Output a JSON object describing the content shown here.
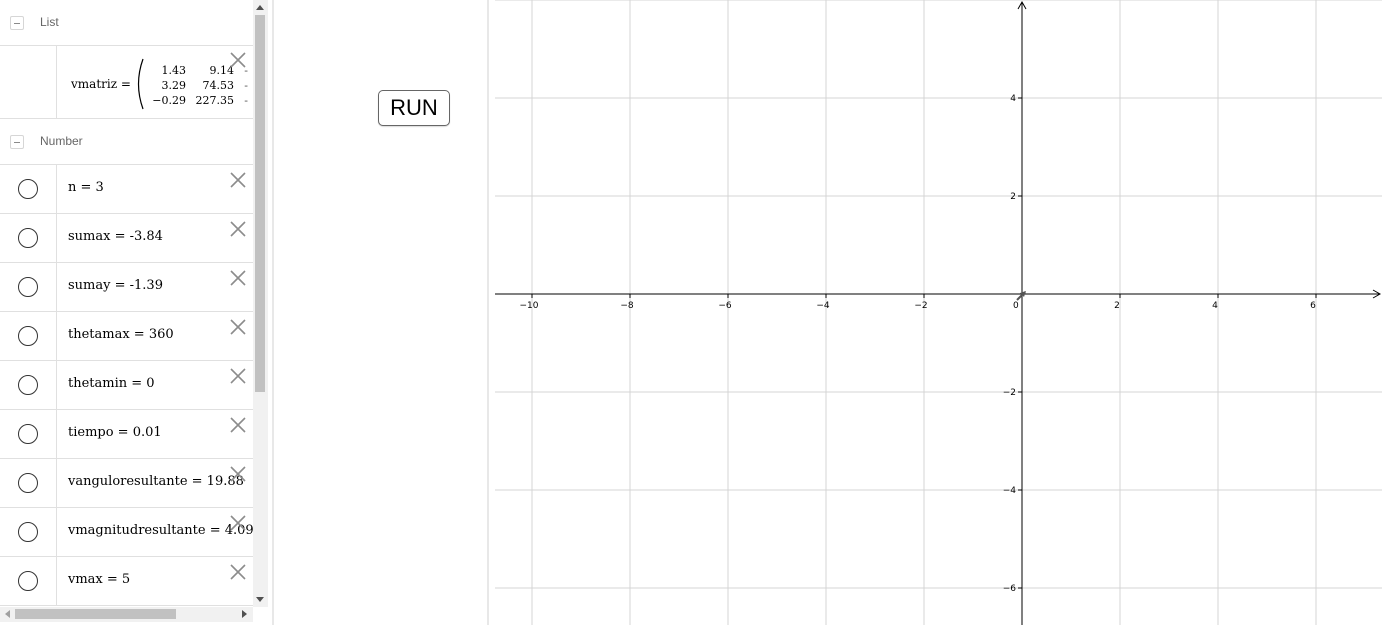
{
  "algebra": {
    "groups": [
      {
        "label": "List"
      },
      {
        "label": "Number"
      }
    ],
    "matrix": {
      "name": "vmatriz =",
      "rows": [
        [
          "1.43",
          "9.14",
          "-"
        ],
        [
          "3.29",
          "74.53",
          "-"
        ],
        [
          "−0.29",
          "227.35",
          "-"
        ]
      ]
    },
    "numbers": [
      {
        "expr": "n = 3"
      },
      {
        "expr": "sumax = -3.84"
      },
      {
        "expr": "sumay = -1.39"
      },
      {
        "expr": "thetamax = 360"
      },
      {
        "expr": "thetamin = 0"
      },
      {
        "expr": "tiempo = 0.01"
      },
      {
        "expr": "vanguloresultante = 19.88"
      },
      {
        "expr": "vmagnitudresultante = 4.09"
      },
      {
        "expr": "vmax = 5"
      }
    ]
  },
  "button": {
    "label": "RUN"
  },
  "axes": {
    "x_ticks": [
      {
        "value": -10,
        "label": "−10"
      },
      {
        "value": -8,
        "label": "−8"
      },
      {
        "value": -6,
        "label": "−6"
      },
      {
        "value": -4,
        "label": "−4"
      },
      {
        "value": -2,
        "label": "−2"
      },
      {
        "value": 0,
        "label": "0"
      },
      {
        "value": 2,
        "label": "2"
      },
      {
        "value": 4,
        "label": "4"
      },
      {
        "value": 6,
        "label": "6"
      }
    ],
    "y_ticks": [
      {
        "value": 4,
        "label": "4"
      },
      {
        "value": 2,
        "label": "2"
      },
      {
        "value": -2,
        "label": "−2"
      },
      {
        "value": -4,
        "label": "−4"
      },
      {
        "value": -6,
        "label": "−6"
      }
    ],
    "colors": {
      "grid": "#d4d4d4",
      "axis": "#000000"
    }
  }
}
